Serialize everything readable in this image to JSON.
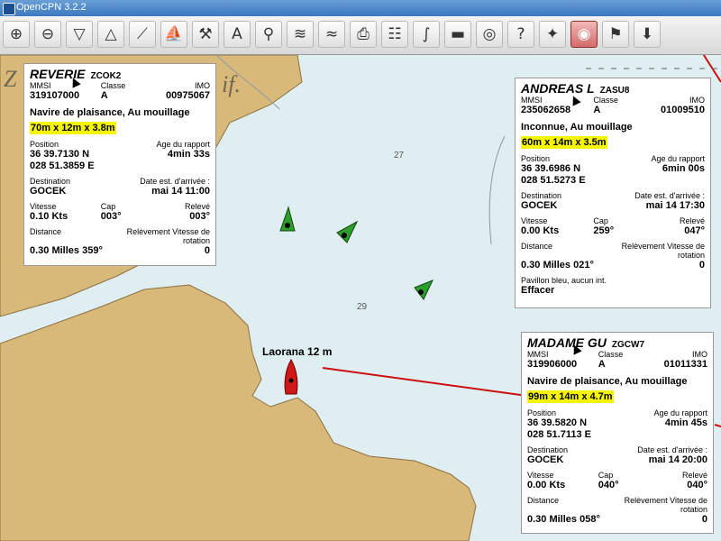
{
  "window": {
    "title": "OpenCPN 3.2.2"
  },
  "toolbar": {
    "buttons": [
      {
        "icon": "zoom-in-icon",
        "glyph": "⊕"
      },
      {
        "icon": "zoom-out-icon",
        "glyph": "⊖"
      },
      {
        "icon": "scale-in-icon",
        "glyph": "▽"
      },
      {
        "icon": "scale-out-icon",
        "glyph": "△"
      },
      {
        "icon": "route-icon",
        "glyph": "⟋"
      },
      {
        "icon": "ship-follow-icon",
        "glyph": "⛵"
      },
      {
        "icon": "settings-icon",
        "glyph": "⚒"
      },
      {
        "icon": "text-icon",
        "glyph": "A"
      },
      {
        "icon": "measure-icon",
        "glyph": "⚲"
      },
      {
        "icon": "tides-icon",
        "glyph": "≋"
      },
      {
        "icon": "currents-icon",
        "glyph": "≈"
      },
      {
        "icon": "print-icon",
        "glyph": "⎙"
      },
      {
        "icon": "route-manager-icon",
        "glyph": "☷"
      },
      {
        "icon": "track-icon",
        "glyph": "∫"
      },
      {
        "icon": "color-scheme-icon",
        "glyph": "▬"
      },
      {
        "icon": "mob-icon",
        "glyph": "◎"
      },
      {
        "icon": "help-icon",
        "glyph": "?"
      },
      {
        "icon": "plugin-icon",
        "glyph": "✦"
      },
      {
        "icon": "ais-target-icon",
        "glyph": "◉"
      },
      {
        "icon": "ais-list-icon",
        "glyph": "⚑"
      },
      {
        "icon": "download-icon",
        "glyph": "⬇"
      }
    ]
  },
  "chart": {
    "depths": [
      "27",
      "29"
    ],
    "land_text": "Z",
    "land_text2": "if.",
    "own_ship_label": "Laorana 12 m"
  },
  "targets": [
    {
      "name": "REVERIE",
      "callsign": "ZCOK2",
      "mmsi_label": "MMSI",
      "mmsi": "319107000",
      "class_label": "Classe",
      "class": "A",
      "imo_label": "IMO",
      "imo": "00975067",
      "desc": "Navire de plaisance, Au mouillage",
      "dims": "70m x 12m x 3.8m",
      "pos_label": "Position",
      "age_label": "Age du rapport",
      "lat": "36 39.7130 N",
      "lon": "028 51.3859 E",
      "age": "4min 33s",
      "dest_label": "Destination",
      "eta_label": "Date est. d'arrivée :",
      "dest": "GOCEK",
      "eta": "mai 14 11:00",
      "sog_label": "Vitesse",
      "cog_label": "Cap",
      "hdg_label": "Relevé",
      "sog": "0.10 Kts",
      "cog": "003°",
      "hdg": "003°",
      "dist_label": "Distance",
      "brg_label": "Relèvement Vitesse de rotation",
      "dist_brg": "0.30 Milles 359°",
      "rot": "0"
    },
    {
      "name": "ANDREAS L",
      "callsign": "ZASU8",
      "mmsi_label": "MMSI",
      "mmsi": "235062658",
      "class_label": "Classe",
      "class": "A",
      "imo_label": "IMO",
      "imo": "01009510",
      "desc": "Inconnue, Au mouillage",
      "dims": "60m x 14m x 3.5m",
      "pos_label": "Position",
      "age_label": "Age du rapport",
      "lat": "36 39.6986 N",
      "lon": "028 51.5273 E",
      "age": "6min 00s",
      "dest_label": "Destination",
      "eta_label": "Date est. d'arrivée :",
      "dest": "GOCEK",
      "eta": "mai 14 17:30",
      "sog_label": "Vitesse",
      "cog_label": "Cap",
      "hdg_label": "Relevé",
      "sog": "0.00 Kts",
      "cog": "259°",
      "hdg": "047°",
      "dist_label": "Distance",
      "brg_label": "Relèvement Vitesse de rotation",
      "dist_brg": "0.30 Milles 021°",
      "rot": "0",
      "flag_label": "Pavillon bleu, aucun int.",
      "clear": "Effacer"
    },
    {
      "name": "MADAME GU",
      "callsign": "ZGCW7",
      "mmsi_label": "MMSI",
      "mmsi": "319906000",
      "class_label": "Classe",
      "class": "A",
      "imo_label": "IMO",
      "imo": "01011331",
      "desc": "Navire de plaisance, Au mouillage",
      "dims": "99m x 14m x 4.7m",
      "pos_label": "Position",
      "age_label": "Age du rapport",
      "lat": "36 39.5820 N",
      "lon": "028 51.7113 E",
      "age": "4min 45s",
      "dest_label": "Destination",
      "eta_label": "Date est. d'arrivée :",
      "dest": "GOCEK",
      "eta": "mai 14 20:00",
      "sog_label": "Vitesse",
      "cog_label": "Cap",
      "hdg_label": "Relevé",
      "sog": "0.00 Kts",
      "cog": "040°",
      "hdg": "040°",
      "dist_label": "Distance",
      "brg_label": "Relèvement Vitesse de rotation",
      "dist_brg": "0.30 Milles 058°",
      "rot": "0"
    }
  ],
  "colors": {
    "water": "#dfeef0",
    "land": "#d9b97a",
    "highlight": "#f5f500",
    "ais_target": "#2a8a2a",
    "own_ship": "#d01818",
    "route_line": "#cc1010"
  }
}
